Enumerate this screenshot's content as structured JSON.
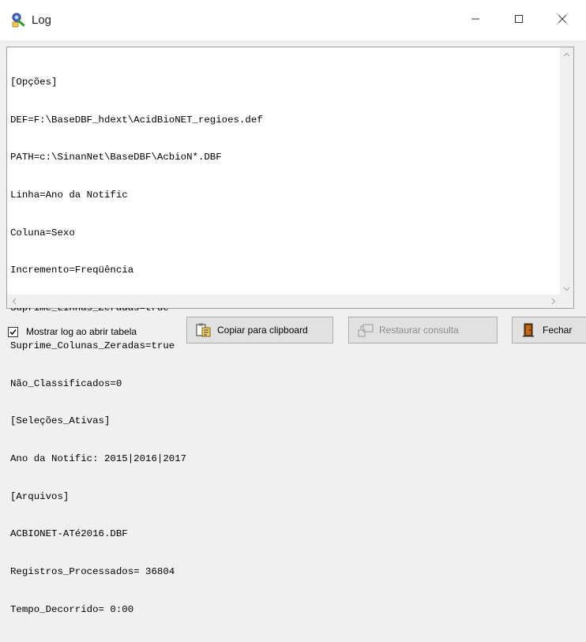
{
  "window": {
    "title": "Log",
    "controls": {
      "minimize": "—",
      "maximize": "☐",
      "close": "✕"
    }
  },
  "log": {
    "lines": [
      "[Opções]",
      "DEF=F:\\BaseDBF_hdext\\AcidBioNET_regioes.def",
      "PATH=c:\\SinanNet\\BaseDBF\\AcbioN*.DBF",
      "Linha=Ano da Notific",
      "Coluna=Sexo",
      "Incremento=Freqüência",
      "Suprime_Linhas_Zeradas=true",
      "Suprime_Colunas_Zeradas=true",
      "Não_Classificados=0",
      "[Seleções_Ativas]",
      "Ano da Notific: 2015|2016|2017",
      "[Arquivos]",
      "ACBIONET-ATé2016.DBF",
      "Registros_Processados= 36804",
      "Tempo_Decorrido= 0:00"
    ]
  },
  "footer": {
    "show_log_checkbox": {
      "label": "Mostrar log ao abrir tabela",
      "checked": true
    },
    "copy_button": "Copiar para clipboard",
    "restore_button": "Restaurar consulta",
    "close_button": "Fechar"
  }
}
